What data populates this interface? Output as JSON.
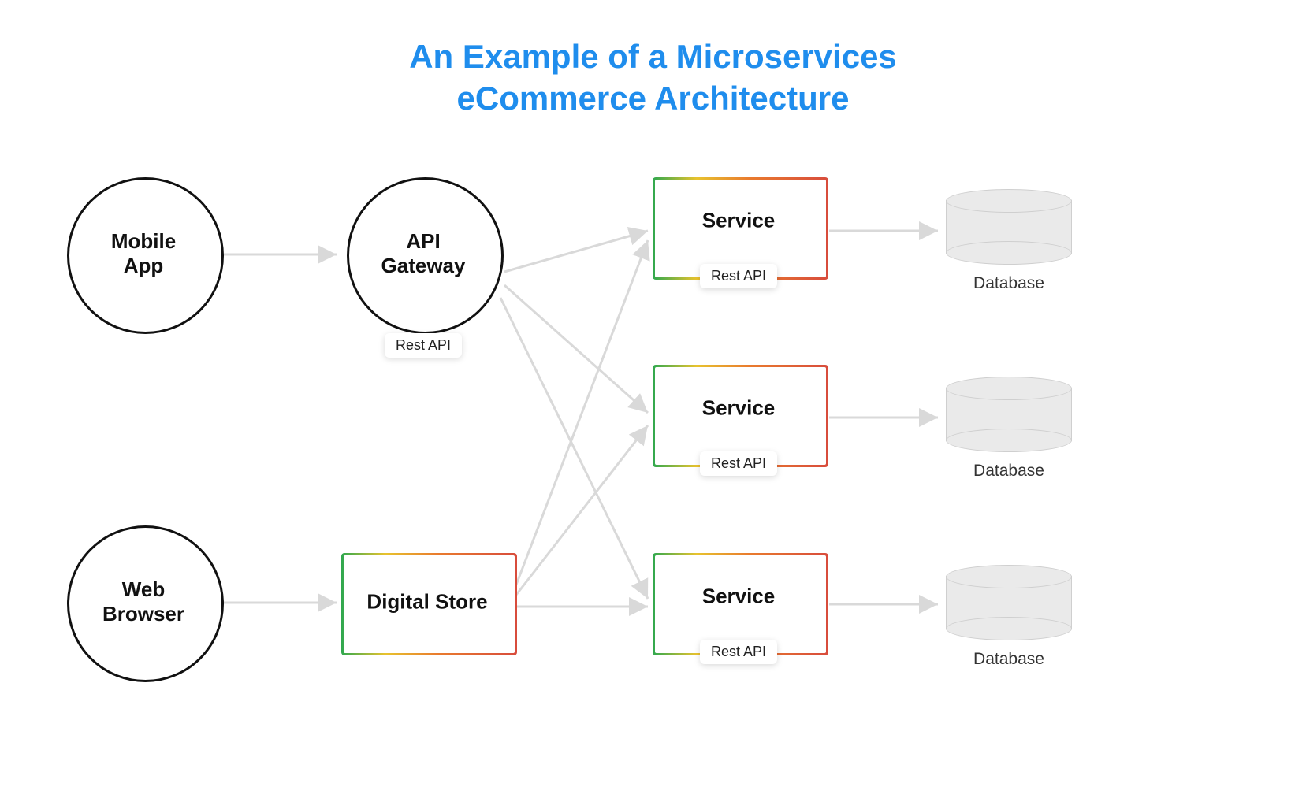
{
  "title": "An Example of a Microservices\neCommerce Architecture",
  "nodes": {
    "mobile_app": "Mobile\nApp",
    "api_gateway": "API\nGateway",
    "api_gateway_chip": "Rest API",
    "web_browser": "Web\nBrowser",
    "digital_store": "Digital Store",
    "service1": "Service",
    "service1_chip": "Rest API",
    "service2": "Service",
    "service2_chip": "Rest API",
    "service3": "Service",
    "service3_chip": "Rest API",
    "db1_caption": "Database",
    "db2_caption": "Database",
    "db3_caption": "Database"
  },
  "colors": {
    "title": "#1f8ded",
    "arrow": "#d9d9d9"
  }
}
